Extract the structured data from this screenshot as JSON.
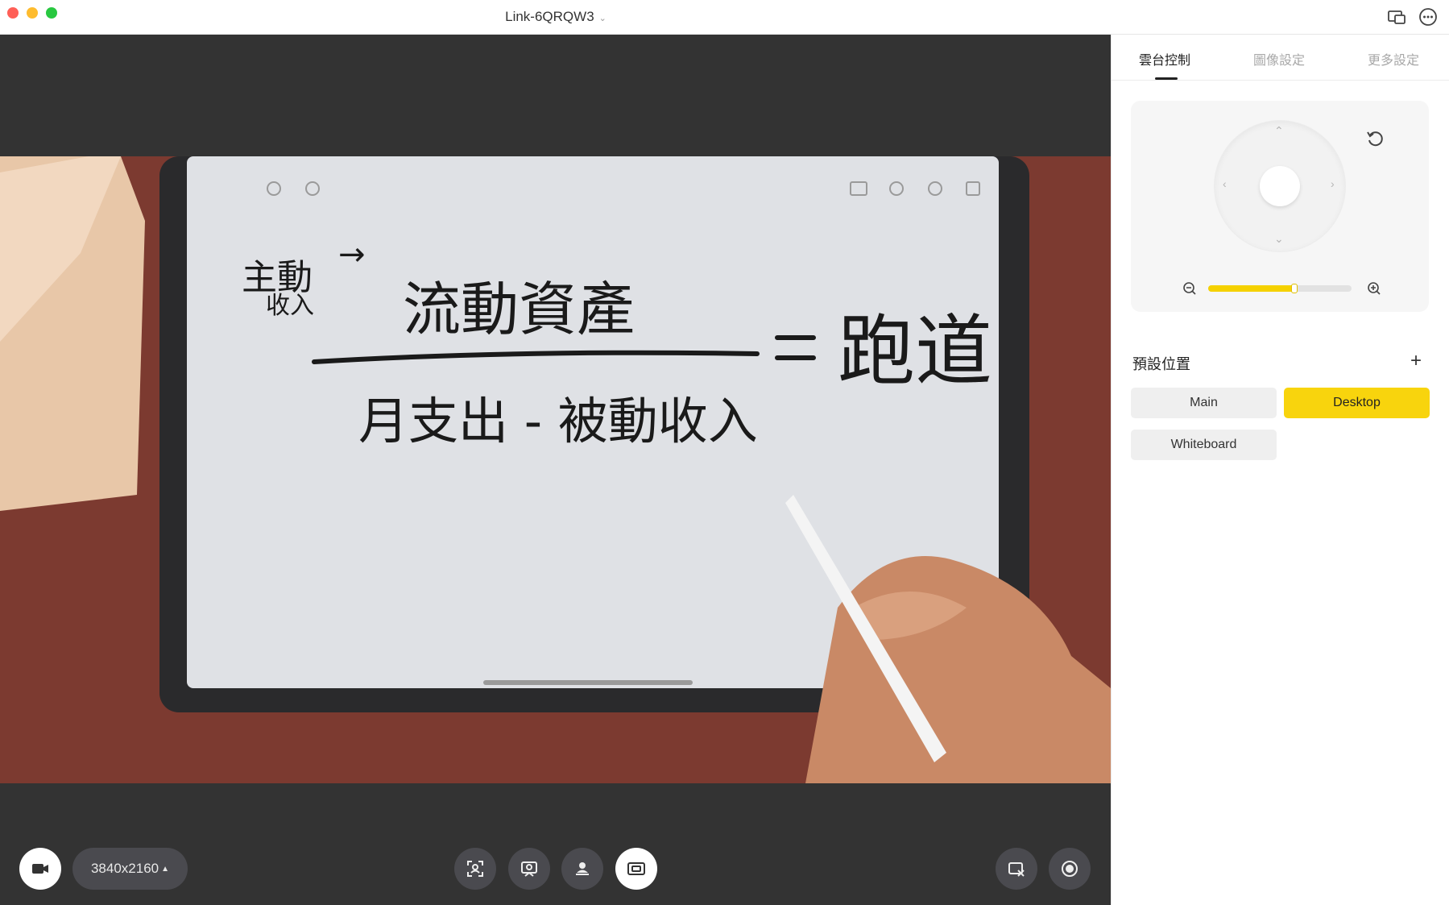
{
  "window": {
    "title": "Link-6QRQW3",
    "icons": [
      "screen-mirror-icon",
      "more-options-icon"
    ]
  },
  "bottom_bar": {
    "resolution": "3840x2160",
    "left_icon": "video-camera-icon",
    "center_icons": [
      "auto-framing-icon",
      "tracking-icon",
      "presenter-mode-icon",
      "desk-mode-icon"
    ],
    "active_mode": "desk-mode-icon",
    "right_icons": [
      "virtual-camera-icon",
      "record-icon"
    ]
  },
  "tabs": [
    {
      "label": "雲台控制",
      "active": true
    },
    {
      "label": "圖像設定",
      "active": false
    },
    {
      "label": "更多設定",
      "active": false
    }
  ],
  "ptz": {
    "zoom_level_fraction": 0.6,
    "icons": [
      "reset-icon",
      "zoom-out-icon",
      "zoom-in-icon",
      "arrow-up-icon",
      "arrow-down-icon",
      "arrow-left-icon",
      "arrow-right-icon"
    ]
  },
  "presets": {
    "title": "預設位置",
    "items": [
      {
        "label": "Main",
        "active": false
      },
      {
        "label": "Desktop",
        "active": true
      },
      {
        "label": "Whiteboard",
        "active": false
      }
    ]
  },
  "video": {
    "handwriting": [
      "主動收入",
      "流動資產",
      "月支出 - 被動收入",
      "= 跑道"
    ]
  },
  "colors": {
    "accent": "#f8d40d",
    "dark_bg": "#333333",
    "button_dark": "#4a4a4f"
  }
}
